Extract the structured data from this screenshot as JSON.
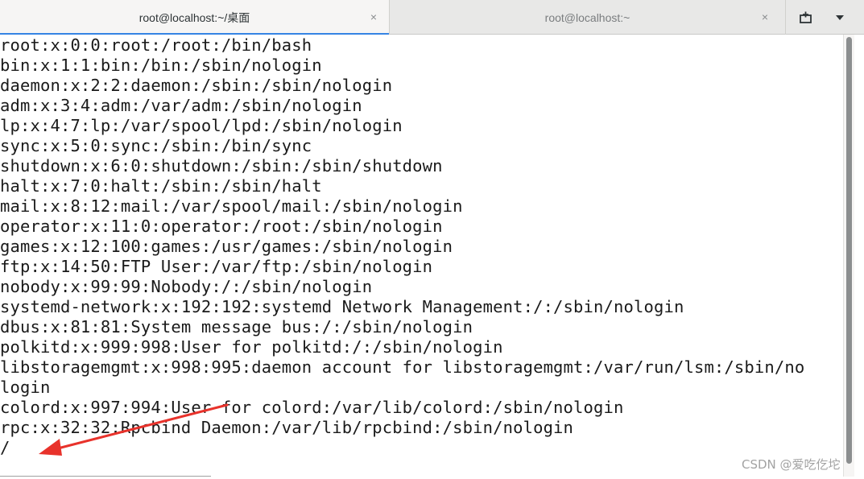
{
  "tabs": [
    {
      "title": "root@localhost:~/桌面",
      "active": true
    },
    {
      "title": "root@localhost:~",
      "active": false
    }
  ],
  "icons": {
    "tab_close": "×",
    "new_tab": "new-tab-icon",
    "menu": "chevron-down-icon"
  },
  "terminal": {
    "lines": [
      "root:x:0:0:root:/root:/bin/bash",
      "bin:x:1:1:bin:/bin:/sbin/nologin",
      "daemon:x:2:2:daemon:/sbin:/sbin/nologin",
      "adm:x:3:4:adm:/var/adm:/sbin/nologin",
      "lp:x:4:7:lp:/var/spool/lpd:/sbin/nologin",
      "sync:x:5:0:sync:/sbin:/bin/sync",
      "shutdown:x:6:0:shutdown:/sbin:/sbin/shutdown",
      "halt:x:7:0:halt:/sbin:/sbin/halt",
      "mail:x:8:12:mail:/var/spool/mail:/sbin/nologin",
      "operator:x:11:0:operator:/root:/sbin/nologin",
      "games:x:12:100:games:/usr/games:/sbin/nologin",
      "ftp:x:14:50:FTP User:/var/ftp:/sbin/nologin",
      "nobody:x:99:99:Nobody:/:/sbin/nologin",
      "systemd-network:x:192:192:systemd Network Management:/:/sbin/nologin",
      "dbus:x:81:81:System message bus:/:/sbin/nologin",
      "polkitd:x:999:998:User for polkitd:/:/sbin/nologin",
      "libstoragemgmt:x:998:995:daemon account for libstoragemgmt:/var/run/lsm:/sbin/no",
      "login",
      "colord:x:997:994:User for colord:/var/lib/colord:/sbin/nologin",
      "rpc:x:32:32:Rpcbind Daemon:/var/lib/rpcbind:/sbin/nologin",
      "/"
    ]
  },
  "annotation": {
    "color": "#e8322b"
  },
  "watermark": "CSDN @爱吃仡坨",
  "colors": {
    "accent": "#3584e4",
    "text": "#1a1a1a"
  }
}
